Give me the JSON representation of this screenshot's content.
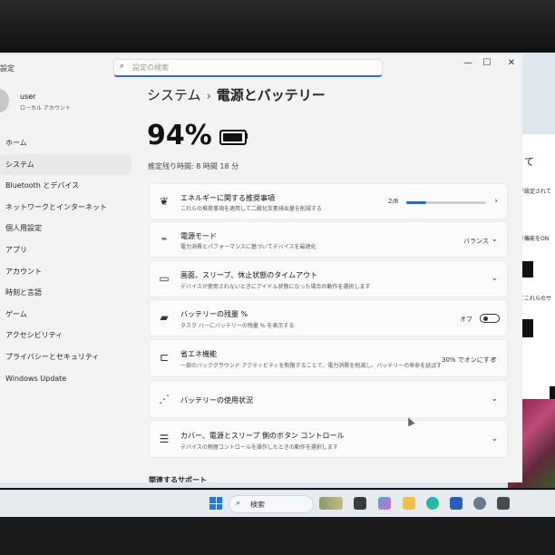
{
  "window": {
    "app_title": "設定",
    "search_placeholder": "設定の検索",
    "controls": {
      "minimize": "—",
      "maximize": "☐",
      "close": "✕"
    }
  },
  "profile": {
    "name": "user",
    "account_type": "ローカル アカウント"
  },
  "sidebar": {
    "items": [
      {
        "label": "ホーム"
      },
      {
        "label": "システム",
        "active": true
      },
      {
        "label": "Bluetooth とデバイス"
      },
      {
        "label": "ネットワークとインターネット"
      },
      {
        "label": "個人用設定"
      },
      {
        "label": "アプリ"
      },
      {
        "label": "アカウント"
      },
      {
        "label": "時刻と言語"
      },
      {
        "label": "ゲーム"
      },
      {
        "label": "アクセシビリティ"
      },
      {
        "label": "プライバシーとセキュリティ"
      },
      {
        "label": "Windows Update"
      }
    ]
  },
  "breadcrumb": {
    "parent": "システム",
    "separator": "›",
    "current": "電源とバッテリー"
  },
  "battery": {
    "percent_text": "94%",
    "level": 0.94,
    "remaining": "推定残り時間: 8 時間 18 分"
  },
  "cards": {
    "energy": {
      "title": "エネルギーに関する推奨事項",
      "subtitle": "これらの推奨事項を適用して二酸化炭素排出量を削減する",
      "progress_text": "2/8",
      "progress": 0.25
    },
    "power_mode": {
      "title": "電源モード",
      "subtitle": "電力消費とパフォーマンスに基づいてデバイスを最適化",
      "value": "バランス"
    },
    "sleep": {
      "title": "画面、スリープ、休止状態のタイムアウト",
      "subtitle": "デバイスが使用されないときにアイドル状態になった場合の動作を選択します"
    },
    "taskbar_pct": {
      "title": "バッテリーの残量 %",
      "subtitle": "タスク バーにバッテリーの残量 % を表示する",
      "value": "オフ"
    },
    "saver": {
      "title": "省エネ機能",
      "subtitle": "一部のバックグラウンド アクティビティを制限することで、電力消費を削減し、バッテリーの寿命を延ばす",
      "value": "30% でオンにする"
    },
    "usage": {
      "title": "バッテリーの使用状況"
    },
    "buttons": {
      "title": "カバー、電源とスリープ 側のボタン コントロール",
      "subtitle": "デバイスの物理コントロールを操作したときの動作を選択します"
    }
  },
  "related": {
    "heading": "関連するサポート"
  },
  "taskbar": {
    "search_label": "検索"
  },
  "background_window": {
    "title": "て",
    "line1": "が設定されて",
    "line2": "き機能をON",
    "line3": "てこれらのサ"
  },
  "colors": {
    "accent": "#2f67c0",
    "window_bg": "#f3f3f3",
    "card_bg": "#fbfbfb"
  }
}
